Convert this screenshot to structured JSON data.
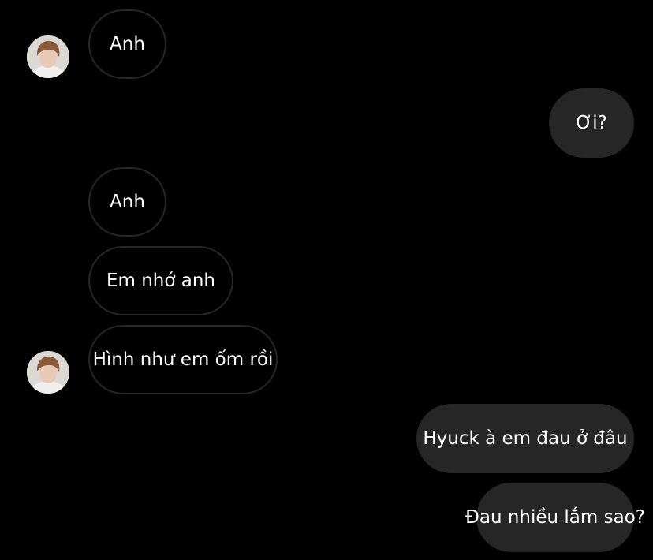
{
  "thread": {
    "messages": [
      {
        "sender": "them",
        "text": "Anh"
      },
      {
        "sender": "me",
        "text": "Ơi?"
      },
      {
        "sender": "them",
        "text": "Anh"
      },
      {
        "sender": "them",
        "text": "Em nhớ anh"
      },
      {
        "sender": "them",
        "text": "Hình như em ốm rồi"
      },
      {
        "sender": "me",
        "text": "Hyuck à em đau ở đâu"
      },
      {
        "sender": "me",
        "text": "Đau nhiều lắm sao?"
      }
    ]
  },
  "colors": {
    "background": "#000000",
    "outgoing_bubble": "#262626",
    "incoming_border": "#262626",
    "text": "#ffffff"
  },
  "icons": {
    "avatar": "contact-avatar-photo"
  }
}
